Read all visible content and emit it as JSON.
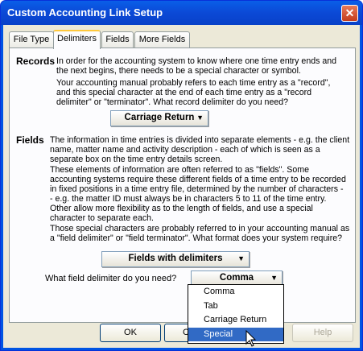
{
  "window": {
    "title": "Custom Accounting Link Setup",
    "close_label": "✕"
  },
  "tabs": [
    {
      "label": "File Type",
      "active": false
    },
    {
      "label": "Delimiters",
      "active": true
    },
    {
      "label": "Fields",
      "active": false
    },
    {
      "label": "More Fields",
      "active": false
    }
  ],
  "records": {
    "heading": "Records",
    "lines": [
      "In order for the accounting system to know where one time entry ends and",
      "the next begins, there needs to be a special character or symbol.",
      "Your accounting manual probably refers to each time entry as a \"record\",",
      "and this special character at the end of each time entry as a \"record",
      "delimiter\" or \"terminator\". What record delimiter do you need?"
    ],
    "select_value": "Carriage Return"
  },
  "fields": {
    "heading": "Fields",
    "lines": [
      "The information in time entries is divided into separate elements - e.g. the client",
      "name, matter name and activity description - each of which is seen as a",
      "separate box on the time entry details screen.",
      "These elements of information are often referred to as \"fields\". Some",
      "accounting systems require these different fields of a time entry to be recorded",
      "in fixed positions in a time entry file, determined by the number of characters -",
      " -  e.g. the matter ID must always be in characters 5 to 11 of the time entry.",
      "Other allow more flexibility as to the length of fields, and use a special",
      "character to separate each.",
      "Those special characters are probably referred to in your accounting manual as",
      "a \"field delimiter\" or \"field terminator\". What format does your system require?"
    ],
    "format_value": "Fields with delimiters",
    "delimiter_question": "What field delimiter do you need?",
    "delimiter_value": "Comma",
    "delimiter_options": [
      "Comma",
      "Tab",
      "Carriage Return",
      "Special"
    ],
    "highlighted_option": "Special"
  },
  "buttons": {
    "ok": "OK",
    "cancel": "C",
    "help": "Help"
  }
}
